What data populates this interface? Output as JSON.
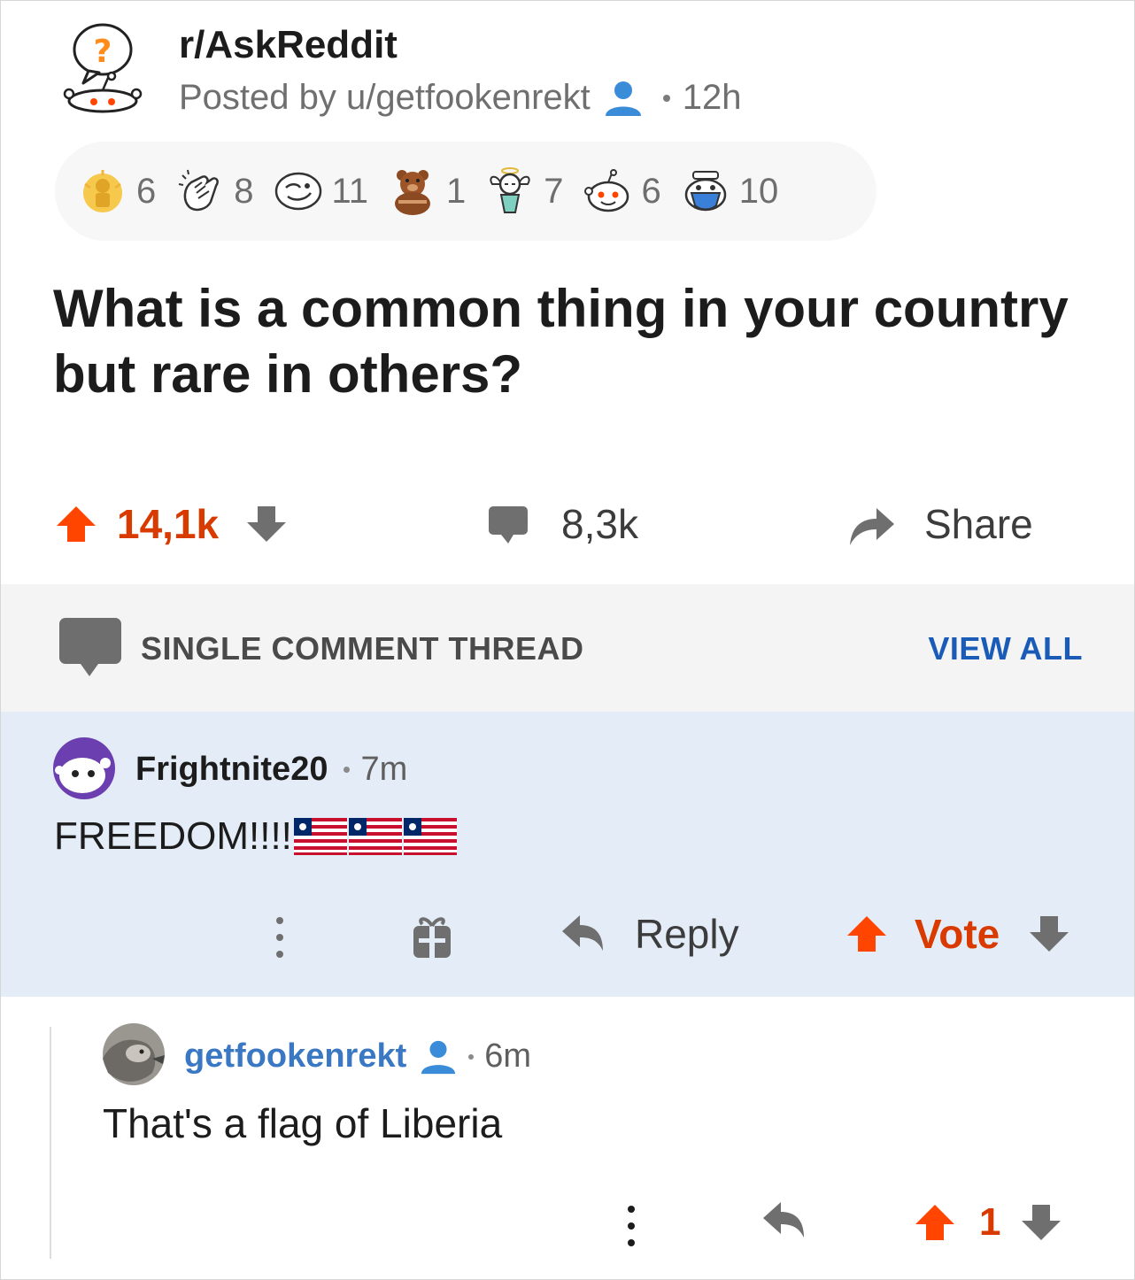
{
  "post": {
    "subreddit": "r/AskReddit",
    "posted_by": "Posted by u/getfookenrekt",
    "age": "12h",
    "title": "What is a common thing in your country but rare in others?",
    "awards": [
      {
        "icon": "gold-award-icon",
        "count": "6"
      },
      {
        "icon": "clapping-hands-award-icon",
        "count": "8"
      },
      {
        "icon": "face-award-icon",
        "count": "11"
      },
      {
        "icon": "bear-award-icon",
        "count": "1"
      },
      {
        "icon": "angel-award-icon",
        "count": "7"
      },
      {
        "icon": "snoo-award-icon",
        "count": "6"
      },
      {
        "icon": "snoo-mask-award-icon",
        "count": "10"
      }
    ],
    "votes": "14,1k",
    "comments": "8,3k",
    "share_label": "Share"
  },
  "thread": {
    "label": "SINGLE COMMENT THREAD",
    "view_all": "VIEW ALL"
  },
  "comment": {
    "user": "Frightnite20",
    "age": "7m",
    "text": "FREEDOM!!!!",
    "flag_emoji_count": 3,
    "reply_label": "Reply",
    "vote_label": "Vote"
  },
  "reply": {
    "user": "getfookenrekt",
    "age": "6m",
    "text": "That's a flag of Liberia",
    "votes": "1"
  },
  "colors": {
    "upvote": "#ff4500",
    "vote_text": "#d93a00",
    "link_blue": "#1a5bb8",
    "op_blue": "#3a78c3",
    "highlight_bg": "#e4edf7",
    "thread_bar_bg": "#f4f4f5"
  }
}
